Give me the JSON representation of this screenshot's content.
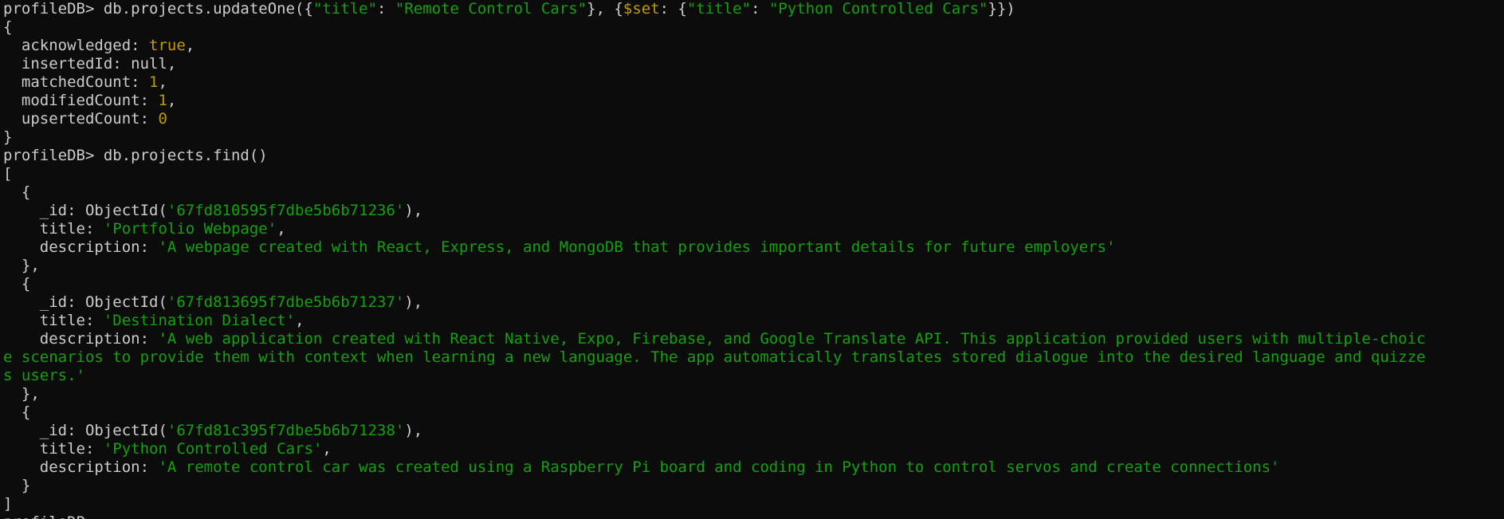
{
  "colors": {
    "background": "#0c0c0c",
    "default_text": "#cccccc",
    "string": "#13a10e",
    "number_bool_operator": "#c19c00"
  },
  "terminal": {
    "lines": [
      [
        {
          "t": "profileDB> db.projects.updateOne({",
          "c": "w"
        },
        {
          "t": "\"title\"",
          "c": "g"
        },
        {
          "t": ": ",
          "c": "w"
        },
        {
          "t": "\"Remote Control Cars\"",
          "c": "g"
        },
        {
          "t": "}, {",
          "c": "w"
        },
        {
          "t": "$set",
          "c": "y"
        },
        {
          "t": ": {",
          "c": "w"
        },
        {
          "t": "\"title\"",
          "c": "g"
        },
        {
          "t": ": ",
          "c": "w"
        },
        {
          "t": "\"Python Controlled Cars\"",
          "c": "g"
        },
        {
          "t": "}})",
          "c": "w"
        }
      ],
      [
        {
          "t": "{",
          "c": "w"
        }
      ],
      [
        {
          "t": "  acknowledged: ",
          "c": "w"
        },
        {
          "t": "true",
          "c": "y"
        },
        {
          "t": ",",
          "c": "w"
        }
      ],
      [
        {
          "t": "  insertedId: null,",
          "c": "w"
        }
      ],
      [
        {
          "t": "  matchedCount: ",
          "c": "w"
        },
        {
          "t": "1",
          "c": "y"
        },
        {
          "t": ",",
          "c": "w"
        }
      ],
      [
        {
          "t": "  modifiedCount: ",
          "c": "w"
        },
        {
          "t": "1",
          "c": "y"
        },
        {
          "t": ",",
          "c": "w"
        }
      ],
      [
        {
          "t": "  upsertedCount: ",
          "c": "w"
        },
        {
          "t": "0",
          "c": "y"
        }
      ],
      [
        {
          "t": "}",
          "c": "w"
        }
      ],
      [
        {
          "t": "profileDB> db.projects.find()",
          "c": "w"
        }
      ],
      [
        {
          "t": "[",
          "c": "w"
        }
      ],
      [
        {
          "t": "  {",
          "c": "w"
        }
      ],
      [
        {
          "t": "    _id: ObjectId(",
          "c": "w"
        },
        {
          "t": "'67fd810595f7dbe5b6b71236'",
          "c": "g"
        },
        {
          "t": "),",
          "c": "w"
        }
      ],
      [
        {
          "t": "    title: ",
          "c": "w"
        },
        {
          "t": "'Portfolio Webpage'",
          "c": "g"
        },
        {
          "t": ",",
          "c": "w"
        }
      ],
      [
        {
          "t": "    description: ",
          "c": "w"
        },
        {
          "t": "'A webpage created with React, Express, and MongoDB that provides important details for future employers'",
          "c": "g"
        }
      ],
      [
        {
          "t": "  },",
          "c": "w"
        }
      ],
      [
        {
          "t": "  {",
          "c": "w"
        }
      ],
      [
        {
          "t": "    _id: ObjectId(",
          "c": "w"
        },
        {
          "t": "'67fd813695f7dbe5b6b71237'",
          "c": "g"
        },
        {
          "t": "),",
          "c": "w"
        }
      ],
      [
        {
          "t": "    title: ",
          "c": "w"
        },
        {
          "t": "'Destination Dialect'",
          "c": "g"
        },
        {
          "t": ",",
          "c": "w"
        }
      ],
      [
        {
          "t": "    description: ",
          "c": "w"
        },
        {
          "t": "'A web application created with React Native, Expo, Firebase, and Google Translate API. This application provided users with multiple-choic",
          "c": "g"
        }
      ],
      [
        {
          "t": "e scenarios to provide them with context when learning a new language. The app automatically translates stored dialogue into the desired language and quizze",
          "c": "g"
        }
      ],
      [
        {
          "t": "s users.'",
          "c": "g"
        }
      ],
      [
        {
          "t": "  },",
          "c": "w"
        }
      ],
      [
        {
          "t": "  {",
          "c": "w"
        }
      ],
      [
        {
          "t": "    _id: ObjectId(",
          "c": "w"
        },
        {
          "t": "'67fd81c395f7dbe5b6b71238'",
          "c": "g"
        },
        {
          "t": "),",
          "c": "w"
        }
      ],
      [
        {
          "t": "    title: ",
          "c": "w"
        },
        {
          "t": "'Python Controlled Cars'",
          "c": "g"
        },
        {
          "t": ",",
          "c": "w"
        }
      ],
      [
        {
          "t": "    description: ",
          "c": "w"
        },
        {
          "t": "'A remote control car was created using a Raspberry Pi board and coding in Python to control servos and create connections'",
          "c": "g"
        }
      ],
      [
        {
          "t": "  }",
          "c": "w"
        }
      ],
      [
        {
          "t": "]",
          "c": "w"
        }
      ],
      [
        {
          "t": "profileDB>",
          "c": "w"
        }
      ]
    ]
  }
}
